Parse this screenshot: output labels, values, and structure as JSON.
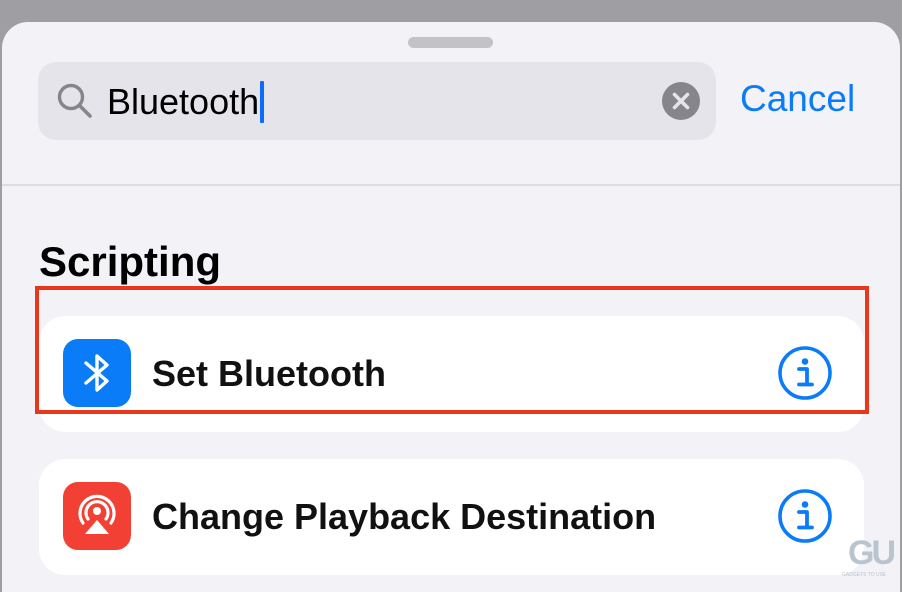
{
  "search": {
    "value": "Bluetooth",
    "cancel_label": "Cancel"
  },
  "section": {
    "title": "Scripting"
  },
  "actions": [
    {
      "label": "Set Bluetooth",
      "icon": "bluetooth-icon",
      "icon_color": "#0a7cf7",
      "highlighted": true
    },
    {
      "label": "Change Playback Destination",
      "icon": "airplay-audio-icon",
      "icon_color": "#f24134",
      "highlighted": false
    }
  ],
  "colors": {
    "accent": "#0a7cf7",
    "highlight_border": "#e8381b",
    "sheet_background": "#f2f2f7"
  },
  "watermark": {
    "logo": "GU",
    "text": "GADGETS TO USE"
  }
}
